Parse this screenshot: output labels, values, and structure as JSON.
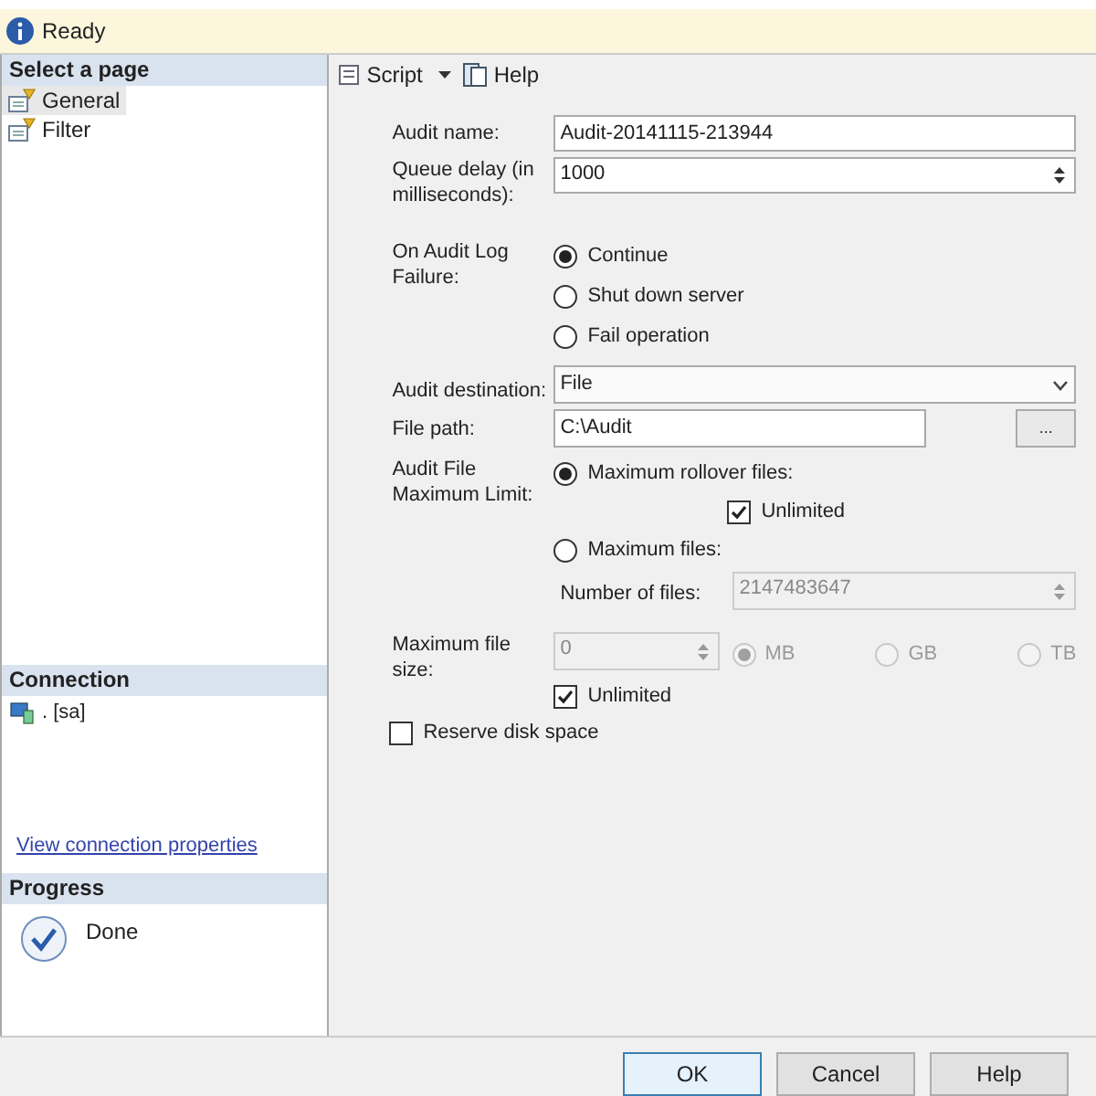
{
  "status_bar": {
    "text": "Ready"
  },
  "select_page": {
    "title": "Select a page",
    "items": [
      {
        "label": "General",
        "selected": true
      },
      {
        "label": "Filter",
        "selected": false
      }
    ]
  },
  "connection": {
    "title": "Connection",
    "server": ". [sa]",
    "link": "View connection properties"
  },
  "progress": {
    "title": "Progress",
    "status": "Done"
  },
  "toolbar": [
    {
      "label": "Script",
      "kind": "dropdown"
    },
    {
      "label": "Help",
      "kind": "plain"
    }
  ],
  "audit_name": {
    "label": "Audit name:",
    "value": "Audit-20141115-213944"
  },
  "queue_delay": {
    "label": "Queue delay (in milliseconds):",
    "value": "1000"
  },
  "on_failure": {
    "label": "On Audit Log Failure:",
    "options": [
      {
        "label": "Continue",
        "selected": true
      },
      {
        "label": "Shut down server",
        "selected": false
      },
      {
        "label": "Fail operation",
        "selected": false
      }
    ]
  },
  "destination": {
    "label": "Audit destination:",
    "value": "File"
  },
  "file_path": {
    "label": "File path:",
    "value": "C:\\Audit",
    "browse": "..."
  },
  "max_limit": {
    "label": "Audit File Maximum Limit:",
    "rollover": {
      "label": "Maximum rollover files:",
      "selected": true,
      "unlimited": {
        "label": "Unlimited",
        "checked": true
      }
    },
    "max_files": {
      "label": "Maximum files:",
      "selected": false,
      "count_label": "Number of files:",
      "count_value": "2147483647",
      "disabled": true
    }
  },
  "max_file_size": {
    "label": "Maximum file size:",
    "value": "0",
    "disabled": true,
    "units": [
      {
        "label": "MB",
        "selected": true
      },
      {
        "label": "GB",
        "selected": false
      },
      {
        "label": "TB",
        "selected": false
      }
    ],
    "unlimited": {
      "label": "Unlimited",
      "checked": true
    }
  },
  "reserve_disk_space": {
    "label": "Reserve disk space",
    "checked": false
  },
  "buttons": [
    {
      "label": "OK",
      "default": true
    },
    {
      "label": "Cancel",
      "default": false
    },
    {
      "label": "Help",
      "default": false
    }
  ]
}
